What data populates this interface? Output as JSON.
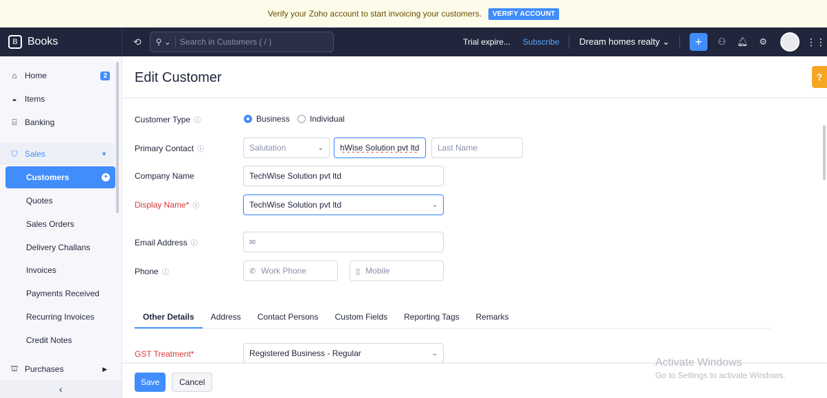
{
  "banner": {
    "message": "Verify your Zoho account to start invoicing your customers.",
    "verify_label": "VERIFY ACCOUNT"
  },
  "topbar": {
    "brand": "Books",
    "search_placeholder": "Search in Customers ( / )",
    "trial": "Trial expire...",
    "subscribe": "Subscribe",
    "org": "Dream homes realty",
    "org_caret": "⌄",
    "plus": "+"
  },
  "sidebar": {
    "home": "Home",
    "home_badge": "2",
    "items": "Items",
    "banking": "Banking",
    "sales": "Sales",
    "sub": [
      "Customers",
      "Quotes",
      "Sales Orders",
      "Delivery Challans",
      "Invoices",
      "Payments Received",
      "Recurring Invoices",
      "Credit Notes"
    ],
    "purchases": "Purchases",
    "collapse": "‹"
  },
  "form": {
    "title": "Edit Customer",
    "customer_type_label": "Customer Type",
    "business": "Business",
    "individual": "Individual",
    "primary_contact_label": "Primary Contact",
    "salutation_placeholder": "Salutation",
    "first_name_value": "hWise Solution pvt ltd",
    "last_name_placeholder": "Last Name",
    "company_name_label": "Company Name",
    "company_name_value": "TechWise Solution pvt ltd",
    "display_name_label": "Display Name*",
    "display_name_value": "TechWise Solution pvt ltd",
    "email_label": "Email Address",
    "phone_label": "Phone",
    "work_phone_placeholder": "Work Phone",
    "mobile_placeholder": "Mobile",
    "gst_label": "GST Treatment*",
    "gst_value": "Registered Business - Regular"
  },
  "tabs": [
    "Other Details",
    "Address",
    "Contact Persons",
    "Custom Fields",
    "Reporting Tags",
    "Remarks"
  ],
  "footer": {
    "save": "Save",
    "cancel": "Cancel"
  },
  "watermark": {
    "line1": "Activate Windows",
    "line2": "Go to Settings to activate Windows."
  },
  "help": "?"
}
